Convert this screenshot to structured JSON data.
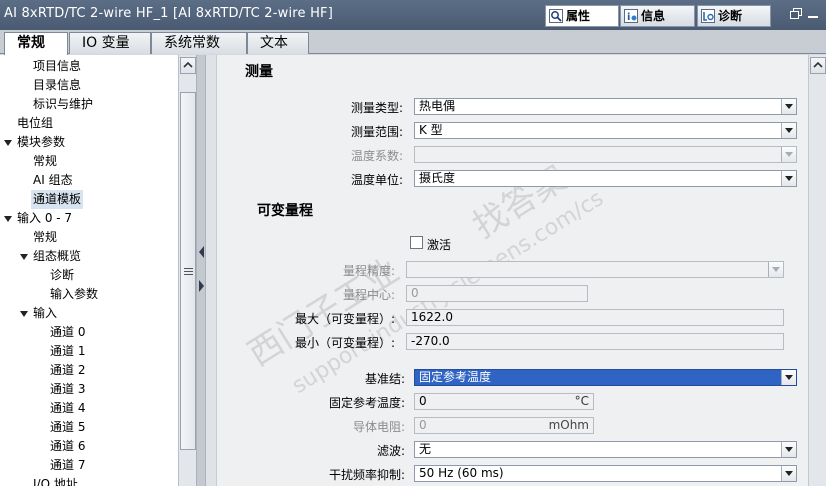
{
  "window": {
    "title": "AI 8xRTD/TC 2-wire HF_1 [AI 8xRTD/TC 2-wire HF]",
    "panel_tabs": [
      {
        "label": "属性",
        "icon": "properties-icon",
        "active": true
      },
      {
        "label": "信息",
        "icon": "info-icon",
        "active": false
      },
      {
        "label": "诊断",
        "icon": "diagnostics-icon",
        "active": false
      }
    ]
  },
  "tabs": [
    {
      "label": "常规",
      "active": true
    },
    {
      "label": "IO 变量",
      "active": false
    },
    {
      "label": "系统常数",
      "active": false
    },
    {
      "label": "文本",
      "active": false
    }
  ],
  "nav": {
    "items": [
      {
        "label": "项目信息",
        "level": 2,
        "expandable": false
      },
      {
        "label": "目录信息",
        "level": 2,
        "expandable": false
      },
      {
        "label": "标识与维护",
        "level": 2,
        "expandable": false
      },
      {
        "label": "电位组",
        "level": 1,
        "expandable": false
      },
      {
        "label": "模块参数",
        "level": 0,
        "expandable": true
      },
      {
        "label": "常规",
        "level": 2,
        "expandable": false
      },
      {
        "label": "AI 组态",
        "level": 2,
        "expandable": false
      },
      {
        "label": "通道模板",
        "level": 2,
        "expandable": false,
        "selected": true
      },
      {
        "label": "输入 0 - 7",
        "level": 0,
        "expandable": true
      },
      {
        "label": "常规",
        "level": 2,
        "expandable": false
      },
      {
        "label": "组态概览",
        "level": 1,
        "expandable": true
      },
      {
        "label": "诊断",
        "level": 3,
        "expandable": false
      },
      {
        "label": "输入参数",
        "level": 3,
        "expandable": false
      },
      {
        "label": "输入",
        "level": 1,
        "expandable": true
      },
      {
        "label": "通道 0",
        "level": 3,
        "expandable": false
      },
      {
        "label": "通道 1",
        "level": 3,
        "expandable": false
      },
      {
        "label": "通道 2",
        "level": 3,
        "expandable": false
      },
      {
        "label": "通道 3",
        "level": 3,
        "expandable": false
      },
      {
        "label": "通道 4",
        "level": 3,
        "expandable": false
      },
      {
        "label": "通道 5",
        "level": 3,
        "expandable": false
      },
      {
        "label": "通道 6",
        "level": 3,
        "expandable": false
      },
      {
        "label": "通道 7",
        "level": 3,
        "expandable": false
      },
      {
        "label": "I/O 地址",
        "level": 2,
        "expandable": false
      }
    ]
  },
  "measurement": {
    "heading": "测量",
    "type_label": "测量类型:",
    "type_value": "热电偶",
    "range_label": "测量范围:",
    "range_value": "K 型",
    "coeff_label": "温度系数:",
    "coeff_value": "",
    "unit_label": "温度单位:",
    "unit_value": "摄氏度"
  },
  "variable_range": {
    "heading": "可变量程",
    "activate_label": "激活",
    "activate_checked": false,
    "precision_label": "量程精度:",
    "precision_value": "",
    "center_label": "量程中心:",
    "center_value": "0",
    "max_label": "最大（可变量程）:",
    "max_value": "1622.0",
    "min_label": "最小（可变量程）:",
    "min_value": "-270.0"
  },
  "reference": {
    "junction_label": "基准结:",
    "junction_value": "固定参考温度",
    "fixed_temp_label": "固定参考温度:",
    "fixed_temp_value": "0",
    "fixed_temp_unit": "°C",
    "wire_res_label": "导体电阻:",
    "wire_res_value": "0",
    "wire_res_unit": "mOhm",
    "filter_label": "滤波:",
    "filter_value": "无",
    "interference_label": "干扰频率抑制:",
    "interference_value": "50 Hz (60 ms)"
  },
  "watermark": {
    "line1": "西门子工业",
    "line2": "support.industry.siemens.com/cs",
    "line3": "找答案"
  }
}
